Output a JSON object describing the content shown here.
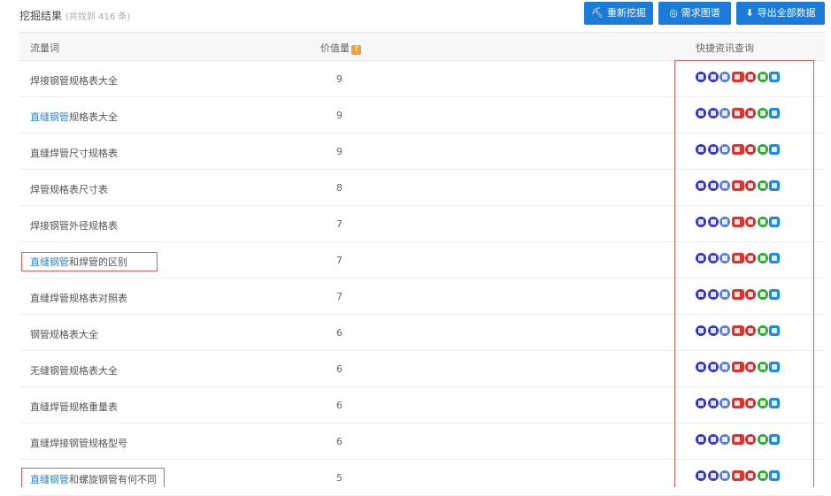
{
  "header": {
    "title": "挖掘结果",
    "subtitle": "(共找到 416 条)",
    "buttons": {
      "remine": "重新挖掘",
      "graph": "需求图谱",
      "export": "导出全部数据"
    }
  },
  "columns": {
    "keyword": "流量词",
    "value": "价值量",
    "value_help": "?",
    "quick": "快捷资讯查询"
  },
  "quick_icons": [
    "baidu-icon",
    "sogou-icon",
    "so360-icon",
    "zhidao-icon",
    "weibo-icon",
    "wechat-icon",
    "zhihu-icon"
  ],
  "colors": {
    "accent": "#1b7bd9",
    "link": "#2d86d6",
    "annotation": "#e15b5b"
  },
  "rows": [
    {
      "highlight": "",
      "rest": "焊接钢管规格表大全",
      "value": "9"
    },
    {
      "highlight": "直缝钢管",
      "rest": "规格表大全",
      "value": "9"
    },
    {
      "highlight": "",
      "rest": "直缝焊管尺寸规格表",
      "value": "9"
    },
    {
      "highlight": "",
      "rest": "焊管规格表尺寸表",
      "value": "8"
    },
    {
      "highlight": "",
      "rest": "焊接钢管外径规格表",
      "value": "7"
    },
    {
      "highlight": "直缝钢管",
      "rest": "和焊管的区别",
      "value": "7"
    },
    {
      "highlight": "",
      "rest": "直缝焊管规格表对照表",
      "value": "7"
    },
    {
      "highlight": "",
      "rest": "钢管规格表大全",
      "value": "6"
    },
    {
      "highlight": "",
      "rest": "无缝钢管规格表大全",
      "value": "6"
    },
    {
      "highlight": "",
      "rest": "直缝焊管规格重量表",
      "value": "6"
    },
    {
      "highlight": "",
      "rest": "直缝焊接钢管规格型号",
      "value": "6"
    },
    {
      "highlight": "直缝钢管",
      "rest": "和螺旋钢管有何不同",
      "value": "5"
    }
  ]
}
